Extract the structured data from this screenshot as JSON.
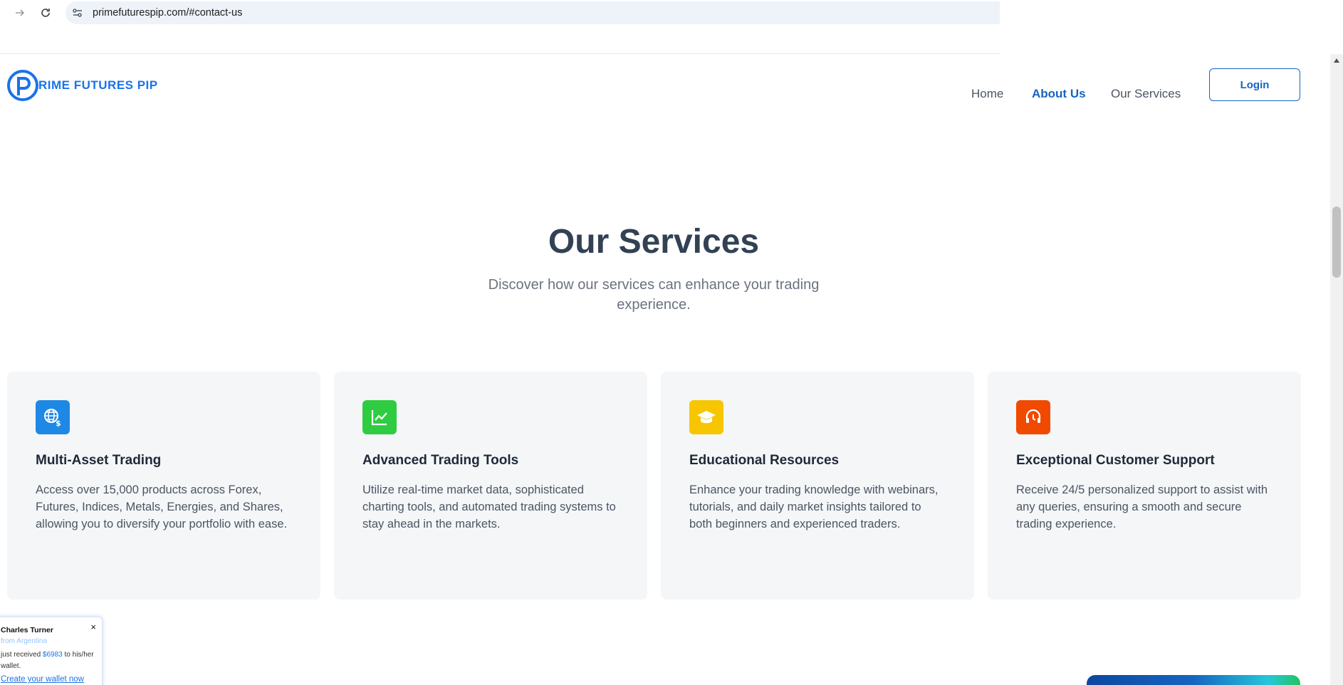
{
  "browser": {
    "url": "primefuturespip.com/#contact-us"
  },
  "header": {
    "logo_text": "RIME FUTURES PIP",
    "nav": [
      {
        "label": "Home",
        "active": false
      },
      {
        "label": "About Us",
        "active": true
      },
      {
        "label": "Our Services",
        "active": false
      }
    ],
    "login_label": "Login"
  },
  "section": {
    "title": "Our Services",
    "subtitle": "Discover how our services can enhance your trading experience."
  },
  "cards": [
    {
      "icon": "globe-dollar-icon",
      "color": "#1e88e5",
      "title": "Multi-Asset Trading",
      "description": "Access over 15,000 products across Forex, Futures, Indices, Metals, Energies, and Shares, allowing you to diversify your portfolio with ease."
    },
    {
      "icon": "chart-line-icon",
      "color": "#2ecc40",
      "title": "Advanced Trading Tools",
      "description": "Utilize real-time market data, sophisticated charting tools, and automated trading systems to stay ahead in the markets."
    },
    {
      "icon": "graduation-cap-icon",
      "color": "#f7c600",
      "title": "Educational Resources",
      "description": "Enhance your trading knowledge with webinars, tutorials, and daily market insights tailored to both beginners and experienced traders."
    },
    {
      "icon": "headset-icon",
      "color": "#f04a00",
      "title": "Exceptional Customer Support",
      "description": "Receive 24/5 personalized support to assist with any queries, ensuring a smooth and secure trading experience."
    }
  ],
  "toast": {
    "close": "×",
    "name": "Charles Turner",
    "from": "from Argentina",
    "msg_prefix": "just received ",
    "amount": "$6983",
    "msg_suffix": " to his/her wallet.",
    "cta": "Create your wallet now"
  }
}
